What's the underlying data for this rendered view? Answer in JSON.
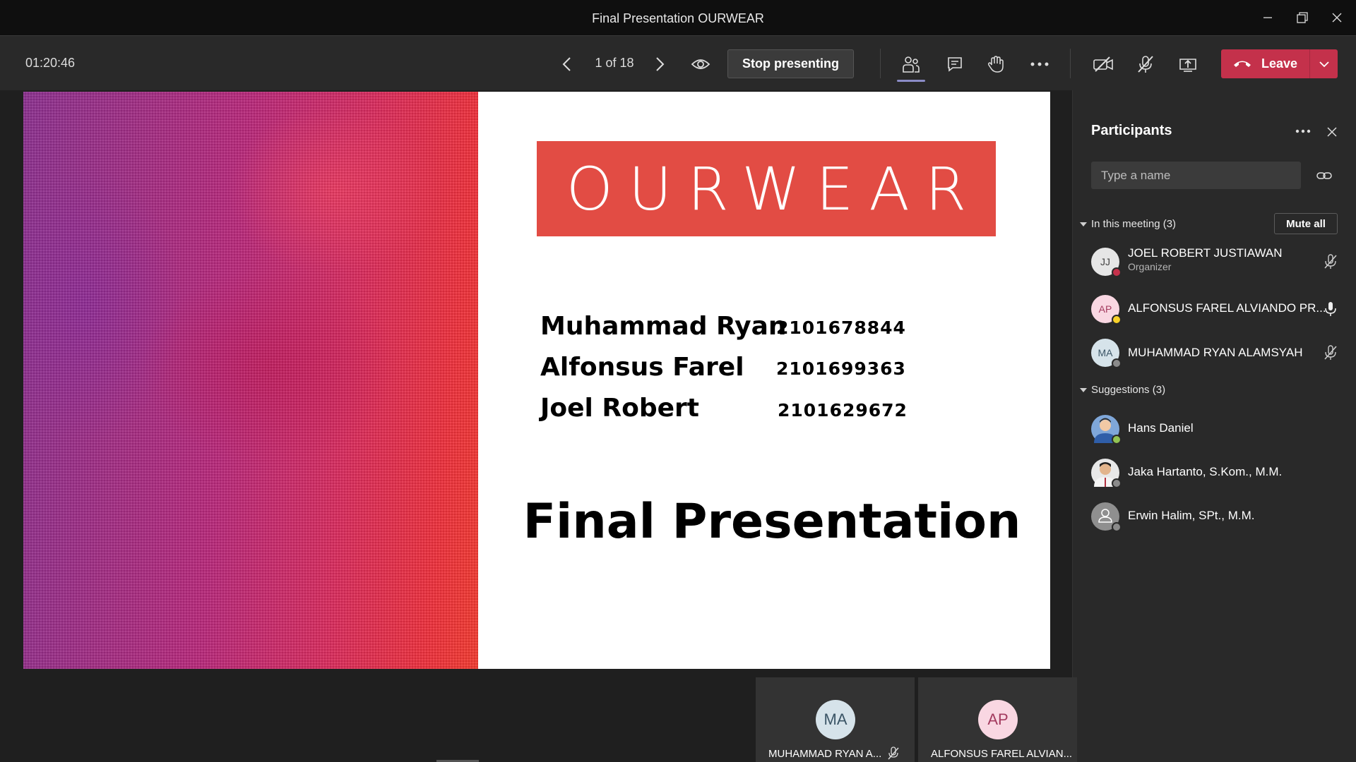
{
  "window": {
    "title": "Final Presentation OURWEAR",
    "controls": [
      "minimize-icon",
      "restore-icon",
      "close-icon"
    ]
  },
  "toolbar": {
    "timer": "01:20:46",
    "page_counter": "1 of 18",
    "stop_presenting_label": "Stop presenting",
    "leave_label": "Leave",
    "icons": [
      "chevron-left-icon",
      "chevron-right-icon",
      "eye-icon",
      "people-icon",
      "chat-icon",
      "raise-hand-icon",
      "more-icon",
      "camera-off-icon",
      "mic-off-icon",
      "share-tray-icon",
      "phone-hangup-icon",
      "chevron-down-icon"
    ],
    "leave_color": "#c4314b"
  },
  "slide": {
    "logo": "OURWEAR",
    "logo_color": "#e24c44",
    "members": [
      {
        "name": "Muhammad Ryan",
        "id": "2101678844"
      },
      {
        "name": "Alfonsus Farel",
        "id": "2101699363"
      },
      {
        "name": "Joel Robert",
        "id": "2101629672"
      }
    ],
    "title": "Final Presentation"
  },
  "participants": {
    "title": "Participants",
    "search_placeholder": "Type a name",
    "in_meeting_header": "In this meeting (3)",
    "mute_all_label": "Mute all",
    "in_meeting": [
      {
        "initials": "JJ",
        "name": "JOEL ROBERT JUSTIAWAN",
        "role": "Organizer",
        "mic": "mic-off-icon",
        "status": "busy",
        "status_color": "#c4314b",
        "avatar_bg": "#e6e6e6",
        "avatar_fg": "#444444"
      },
      {
        "initials": "AP",
        "name": "ALFONSUS FAREL ALVIANDO PR...",
        "role": "",
        "mic": "mic-on-icon",
        "status": "away",
        "status_color": "#f8d22a",
        "avatar_bg": "#f9d7e2",
        "avatar_fg": "#a33b5f"
      },
      {
        "initials": "MA",
        "name": "MUHAMMAD RYAN ALAMSYAH",
        "role": "",
        "mic": "mic-off-icon",
        "status": "offline",
        "status_color": "#8a8a8a",
        "avatar_bg": "#d6e3ea",
        "avatar_fg": "#3b5566"
      }
    ],
    "suggestions_header": "Suggestions (3)",
    "suggestions": [
      {
        "name": "Hans Daniel",
        "status": "available",
        "status_color": "#92c353"
      },
      {
        "name": "Jaka Hartanto, S.Kom., M.M.",
        "status": "offline",
        "status_color": "#8a8a8a"
      },
      {
        "name": "Erwin Halim, SPt., M.M.",
        "status": "offline",
        "status_color": "#8a8a8a"
      }
    ]
  },
  "tiles": [
    {
      "initials": "MA",
      "name": "MUHAMMAD RYAN A...",
      "mic": "mic-off-icon"
    },
    {
      "initials": "AP",
      "name": "ALFONSUS FAREL ALVIAN..."
    }
  ]
}
